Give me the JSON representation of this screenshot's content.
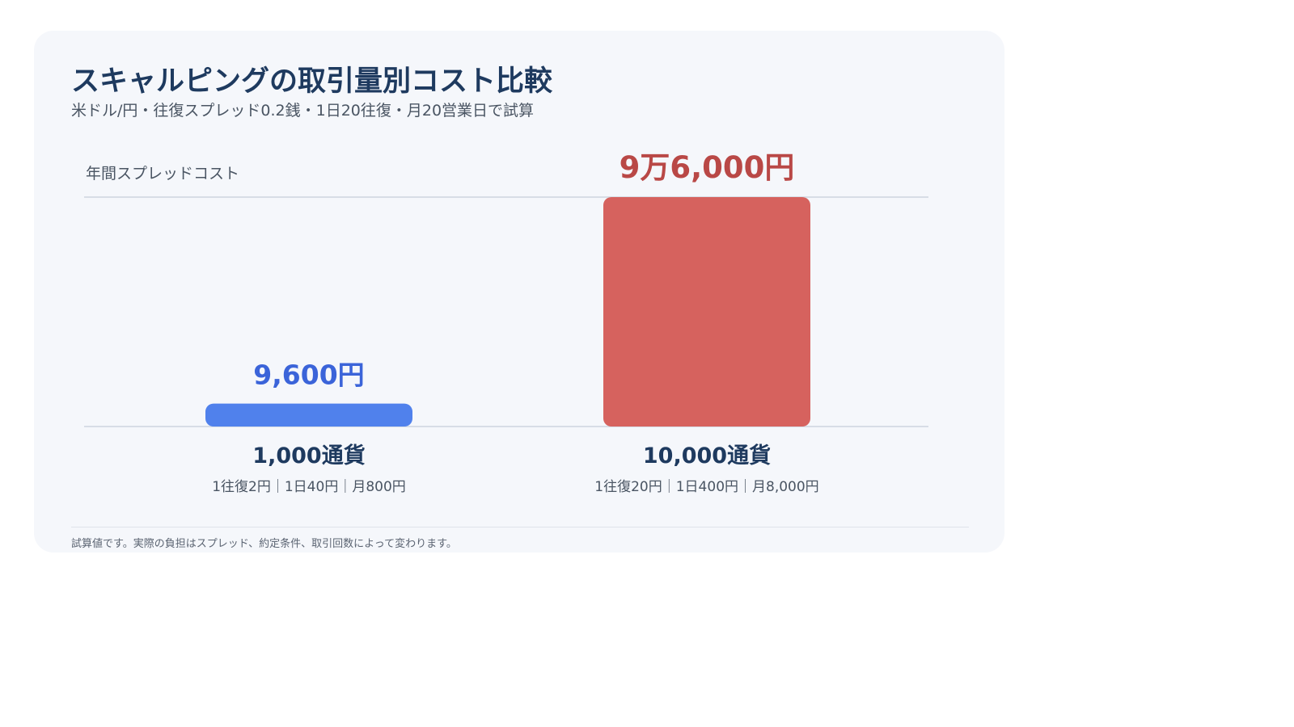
{
  "title": "スキャルピングの取引量別コスト比較",
  "subtitle": "米ドル/円・往復スプレッド0.2銭・1日20往復・月20営業日で試算",
  "footnote": "試算値です。実際の負担はスプレッド、約定条件、取引回数によって変わります。",
  "colors": {
    "bar_small": "#5081ec",
    "bar_large": "#d6625e",
    "label_small": "#3b64d9",
    "label_large": "#b94846",
    "axis_text": "#1e3a5f",
    "grid": "#d7dde6"
  },
  "chart_data": {
    "type": "bar",
    "ylabel": "年間スプレッドコスト",
    "ylim": [
      0,
      96000
    ],
    "grid": "top-and-baseline",
    "categories": [
      "1,000通貨",
      "10,000通貨"
    ],
    "values": [
      9600,
      96000
    ],
    "value_labels": [
      "9,600円",
      "9万6,000円"
    ],
    "details": [
      "1往復2円｜1日40円｜月800円",
      "1往復20円｜1日400円｜月8,000円"
    ]
  }
}
